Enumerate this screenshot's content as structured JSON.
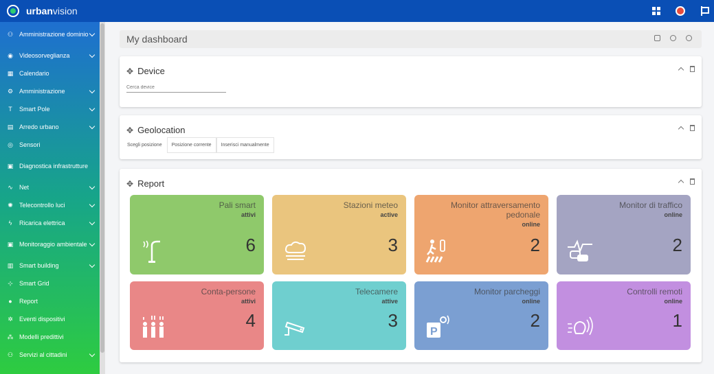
{
  "app": {
    "brand_bold": "urban",
    "brand_light": "vision"
  },
  "sidebar": {
    "items": [
      {
        "label": "Amministrazione dominio",
        "icon": "users-icon",
        "chevron": true,
        "tall": true
      },
      {
        "label": "Videosorveglianza",
        "icon": "camera-icon",
        "chevron": true
      },
      {
        "label": "Calendario",
        "icon": "calendar-icon",
        "chevron": false
      },
      {
        "label": "Amministrazione",
        "icon": "admin-icon",
        "chevron": true
      },
      {
        "label": "Smart Pole",
        "icon": "pole-icon",
        "chevron": true
      },
      {
        "label": "Arredo urbano",
        "icon": "bench-icon",
        "chevron": true
      },
      {
        "label": "Sensori",
        "icon": "sensor-icon",
        "chevron": false
      },
      {
        "label": "Diagnostica infrastrutture",
        "icon": "chart-icon",
        "chevron": false,
        "tall": true
      },
      {
        "label": "Net",
        "icon": "wifi-icon",
        "chevron": true
      },
      {
        "label": "Telecontrollo luci",
        "icon": "light-icon",
        "chevron": true
      },
      {
        "label": "Ricarica elettrica",
        "icon": "charge-icon",
        "chevron": true
      },
      {
        "label": "Monitoraggio ambientale",
        "icon": "monitor-icon",
        "chevron": true,
        "tall": true
      },
      {
        "label": "Smart building",
        "icon": "building-icon",
        "chevron": true
      },
      {
        "label": "Smart Grid",
        "icon": "grid-icon",
        "chevron": false
      },
      {
        "label": "Report",
        "icon": "report-icon",
        "chevron": false
      },
      {
        "label": "Eventi dispositivi",
        "icon": "gear-icon",
        "chevron": false
      },
      {
        "label": "Modelli predittivi",
        "icon": "model-icon",
        "chevron": false
      },
      {
        "label": "Servizi al cittadini",
        "icon": "citizen-icon",
        "chevron": true
      }
    ]
  },
  "dashboard": {
    "title": "My dashboard"
  },
  "device": {
    "title": "Device",
    "search_placeholder": "Cerca device"
  },
  "geolocation": {
    "title": "Geolocation",
    "options": [
      "Scegli posizione",
      "Posizione corrente",
      "Inserisci manualmente"
    ]
  },
  "report": {
    "title": "Report",
    "tiles": [
      {
        "name": "Pali smart",
        "status": "attivi",
        "count": "6",
        "color": "#8fc96b",
        "icon": "streetlight-icon"
      },
      {
        "name": "Stazioni meteo",
        "status": "active",
        "count": "3",
        "color": "#eac57e",
        "icon": "cloud-icon"
      },
      {
        "name": "Monitor attraversamento pedonale",
        "status": "online",
        "count": "2",
        "color": "#eea56f",
        "icon": "pedestrian-icon"
      },
      {
        "name": "Monitor di traffico",
        "status": "online",
        "count": "2",
        "color": "#a4a4c2",
        "icon": "traffic-icon"
      },
      {
        "name": "Conta-persone",
        "status": "attivi",
        "count": "4",
        "color": "#e98787",
        "icon": "people-icon"
      },
      {
        "name": "Telecamere",
        "status": "attive",
        "count": "3",
        "color": "#6fcfcf",
        "icon": "cctv-icon"
      },
      {
        "name": "Monitor parcheggi",
        "status": "online",
        "count": "2",
        "color": "#7b9fd2",
        "icon": "parking-icon"
      },
      {
        "name": "Controlli remoti",
        "status": "online",
        "count": "1",
        "color": "#c28fe0",
        "icon": "remote-icon"
      }
    ]
  }
}
